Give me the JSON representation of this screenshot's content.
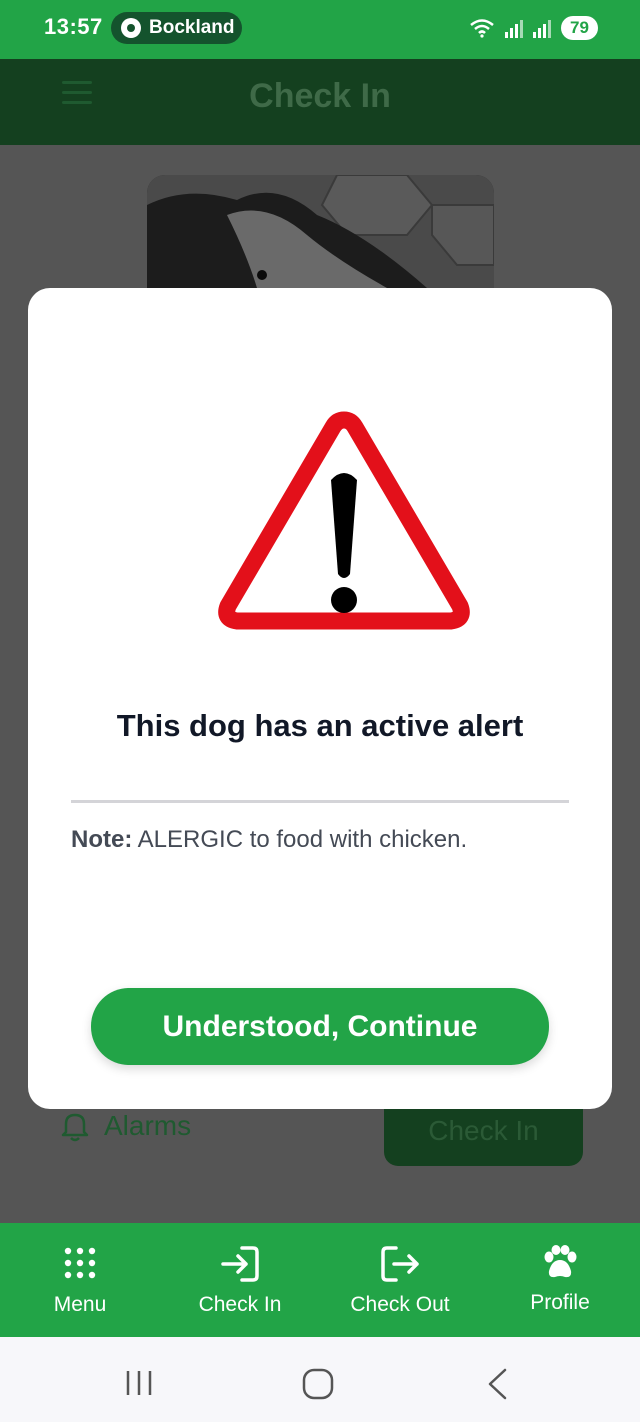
{
  "status_bar": {
    "time": "13:57",
    "chrome_label": "Bockland",
    "battery": "79"
  },
  "app_bar": {
    "title": "Check In"
  },
  "background": {
    "alarms_label": "Alarms",
    "check_in_button": "Check In"
  },
  "modal": {
    "title": "This dog has an active alert",
    "note_label": "Note:",
    "note_text": "ALERGIC to food with chicken.",
    "continue_label": "Understood, Continue"
  },
  "bottom_nav": {
    "items": [
      {
        "label": "Menu",
        "icon": "grid-dots-icon"
      },
      {
        "label": "Check In",
        "icon": "login-arrow-icon"
      },
      {
        "label": "Check Out",
        "icon": "logout-arrow-icon"
      },
      {
        "label": "Profile",
        "icon": "paw-icon"
      }
    ]
  },
  "colors": {
    "brand_green": "#22a447",
    "dark_green": "#14401f",
    "alert_red": "#e3101a"
  }
}
